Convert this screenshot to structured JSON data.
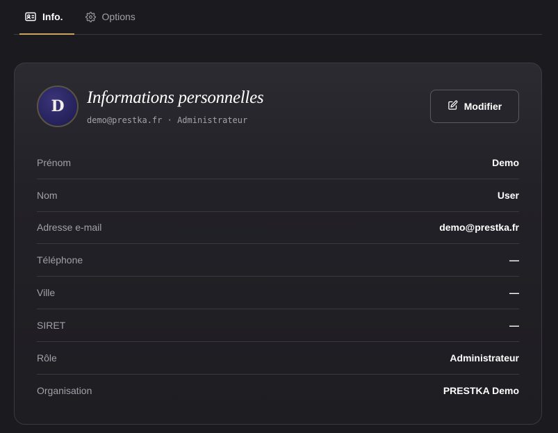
{
  "tabs": [
    {
      "label": "Info.",
      "icon": "id-card-icon",
      "active": true
    },
    {
      "label": "Options",
      "icon": "gear-icon",
      "active": false
    }
  ],
  "colors": {
    "accent": "#c9a65b",
    "background": "#1b1a1f",
    "avatar": "#2a2566"
  },
  "profile": {
    "initial": "D",
    "title": "Informations personnelles",
    "email": "demo@prestka.fr",
    "separator": "·",
    "role": "Administrateur",
    "edit_label": "Modifier",
    "edit_icon": "pencil-icon"
  },
  "fields": [
    {
      "label": "Prénom",
      "value": "Demo"
    },
    {
      "label": "Nom",
      "value": "User"
    },
    {
      "label": "Adresse e-mail",
      "value": "demo@prestka.fr"
    },
    {
      "label": "Téléphone",
      "value": "—"
    },
    {
      "label": "Ville",
      "value": "—"
    },
    {
      "label": "SIRET",
      "value": "—"
    },
    {
      "label": "Rôle",
      "value": "Administrateur"
    },
    {
      "label": "Organisation",
      "value": "PRESTKA Demo"
    }
  ]
}
